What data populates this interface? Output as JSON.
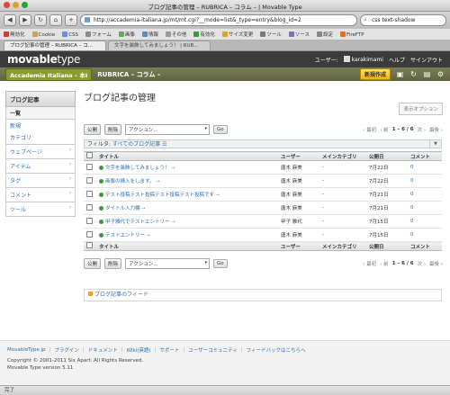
{
  "window": {
    "title": "ブログ記事の管理 – RUBRICA – コラム – | Movable Type"
  },
  "toolbar": {
    "url": "http://accademia-italiana.jp/mt/mt.cgi?__mode=list&_type=entry&blog_id=2",
    "search": "css text-shadow"
  },
  "bookmarks": [
    "無効化",
    "Cookie",
    "CSS",
    "フォーム",
    "画像",
    "情報",
    "その他",
    "有効化",
    "サイズ変更",
    "ツール",
    "ソース",
    "設定",
    "FireFTP"
  ],
  "tabs": [
    "ブログ記事の管理 – RUBRICA – コ...",
    "文字を装飾してみましょう！ | RUB..."
  ],
  "mt": {
    "logo_bold": "movable",
    "logo_rest": "type",
    "user_label": "ユーザー:",
    "username": "karakimami",
    "help": "ヘルプ",
    "signout": "サインアウト"
  },
  "blogbar": {
    "site": "Accademia Italiana – 本Ⅰ",
    "blog": "RUBRICA – コラム –",
    "new": "新規作成"
  },
  "sidebar": {
    "head": "ブログ記事",
    "sub": "一覧",
    "links": [
      "新規",
      "カテゴリ"
    ],
    "items": [
      "ウェブページ",
      "アイテム",
      "タグ",
      "コメント",
      "ツール"
    ]
  },
  "page": {
    "title": "ブログ記事の管理",
    "display_options": "表示オプション"
  },
  "actions": {
    "publish": "公開",
    "delete": "削除",
    "select": "アクション...",
    "go": "Go"
  },
  "pager": {
    "prev": "‹ 最初",
    "back": "‹ 前",
    "range": "1 – 6 / 6",
    "next": "次 ›",
    "last": "最後 ›"
  },
  "filter": {
    "label": "フィルタ:",
    "value": "すべてのブログ記事"
  },
  "table": {
    "headers": [
      "タイトル",
      "ユーザー",
      "メインカテゴリ",
      "公開日",
      "コメント"
    ],
    "rows": [
      {
        "title": "文字を装飾してみましょう！",
        "user": "唐木 麻美",
        "category": "-",
        "date": "7月22日",
        "comments": "0"
      },
      {
        "title": "画像の挿入をします。",
        "user": "唐木 麻美",
        "category": "-",
        "date": "7月22日",
        "comments": "0"
      },
      {
        "title": "テスト投稿テスト投稿テスト投稿テスト投稿です",
        "user": "唐木 麻美",
        "category": "-",
        "date": "7月21日",
        "comments": "0"
      },
      {
        "title": "タイトル入力欄",
        "user": "唐木 麻美",
        "category": "-",
        "date": "7月21日",
        "comments": "0"
      },
      {
        "title": "甲子雅代でテストエントリー",
        "user": "甲子 雅代",
        "category": "-",
        "date": "7月15日",
        "comments": "0"
      },
      {
        "title": "テストエントリー",
        "user": "唐木 麻美",
        "category": "-",
        "date": "7月15日",
        "comments": "0"
      }
    ]
  },
  "feed": "ブログ記事のフィード",
  "footer": {
    "links": [
      "MovableType.jp",
      "プラグイン",
      "ドキュメント",
      "Wiki(英語)",
      "サポート",
      "ユーザーコミュニティ",
      "フィードバックはこちらへ"
    ],
    "copyright": "Copyright © 2001-2011 Six Apart. All Rights Reserved.",
    "version": "Movable Type version 5.11"
  },
  "status": "完了"
}
